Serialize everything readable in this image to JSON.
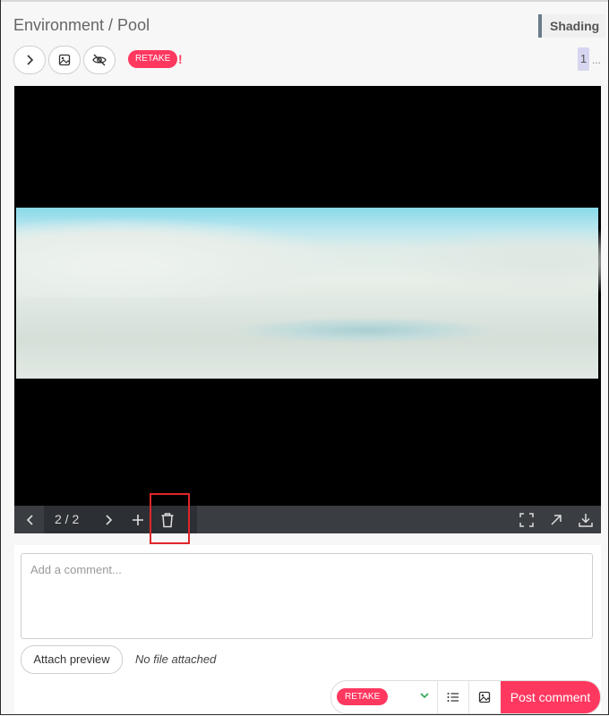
{
  "header": {
    "breadcrumb": "Environment / Pool",
    "task_type": "Shading"
  },
  "toolbar": {
    "status": "RETAKE",
    "status_alert": "!",
    "page_indicator": "1",
    "page_more": "..."
  },
  "player": {
    "frame_counter": "2 / 2"
  },
  "comment": {
    "placeholder": "Add a comment...",
    "attach_label": "Attach preview",
    "no_file_text": "No file attached",
    "status": "RETAKE",
    "post_label": "Post comment"
  },
  "colors": {
    "accent": "#ff3860",
    "task_tag_border": "#6b7b8c",
    "highlight": "#e0262b"
  },
  "icons": [
    "chevron-right-icon",
    "image-icon",
    "eye-off-icon",
    "chevron-left-icon",
    "plus-icon",
    "trash-icon",
    "fullscreen-icon",
    "open-external-icon",
    "download-icon",
    "chevron-down-icon",
    "list-icon"
  ]
}
